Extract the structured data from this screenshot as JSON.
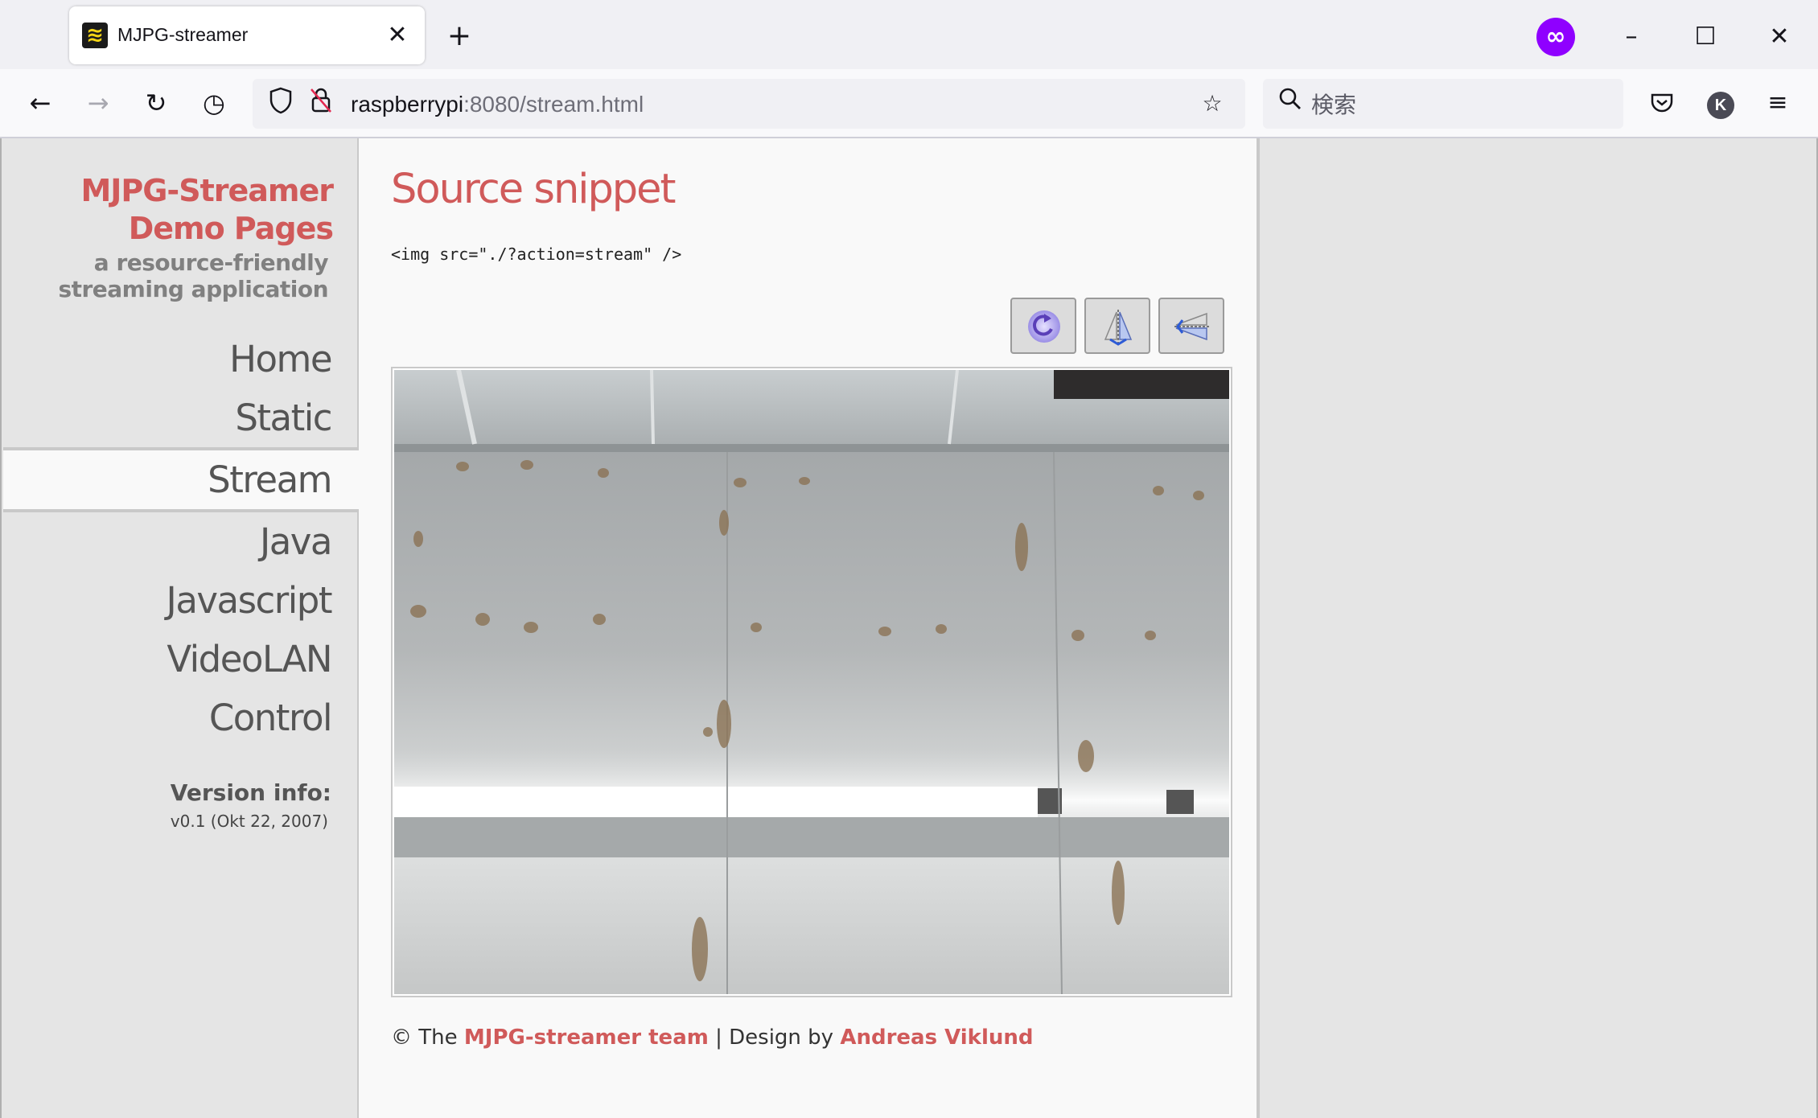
{
  "browser": {
    "tab_title": "MJPG-streamer",
    "url_host": "raspberrypi",
    "url_rest": ":8080/stream.html",
    "search_placeholder": "検索",
    "avatar_letter": "K",
    "icons": {
      "favicon": "mjpg-favicon",
      "close_tab": "close-icon",
      "new_tab": "plus-icon",
      "private": "private-browsing-icon",
      "back": "back-arrow-icon",
      "forward": "forward-arrow-icon",
      "reload": "reload-icon",
      "history": "clock-icon",
      "shield": "shield-icon",
      "insecure": "insecure-lock-icon",
      "bookmark": "star-icon",
      "search": "search-icon",
      "pocket": "pocket-icon",
      "menu": "hamburger-menu-icon"
    }
  },
  "sidebar": {
    "brand_line1": "MJPG-Streamer",
    "brand_line2": "Demo Pages",
    "tagline_line1": "a resource-friendly",
    "tagline_line2": "streaming application",
    "menu": [
      {
        "label": "Home",
        "active": false
      },
      {
        "label": "Static",
        "active": false
      },
      {
        "label": "Stream",
        "active": true
      },
      {
        "label": "Java",
        "active": false
      },
      {
        "label": "Javascript",
        "active": false
      },
      {
        "label": "VideoLAN",
        "active": false
      },
      {
        "label": "Control",
        "active": false
      }
    ],
    "version_heading": "Version info:",
    "version_text": "v0.1 (Okt 22, 2007)"
  },
  "content": {
    "heading": "Source snippet",
    "code": "<img src=\"./?action=stream\" />",
    "controls": [
      "rotate-icon",
      "flip-vertical-icon",
      "flip-horizontal-icon"
    ],
    "footer": {
      "prefix": "© The ",
      "team_link": "MJPG-streamer team",
      "middle": " | Design by ",
      "designer_link": "Andreas Viklund"
    }
  },
  "colors": {
    "accent": "#d05a5a",
    "sidebar_bg": "#e5e5e5",
    "content_bg": "#f9f9f9",
    "private_purple": "#8f00ff"
  }
}
